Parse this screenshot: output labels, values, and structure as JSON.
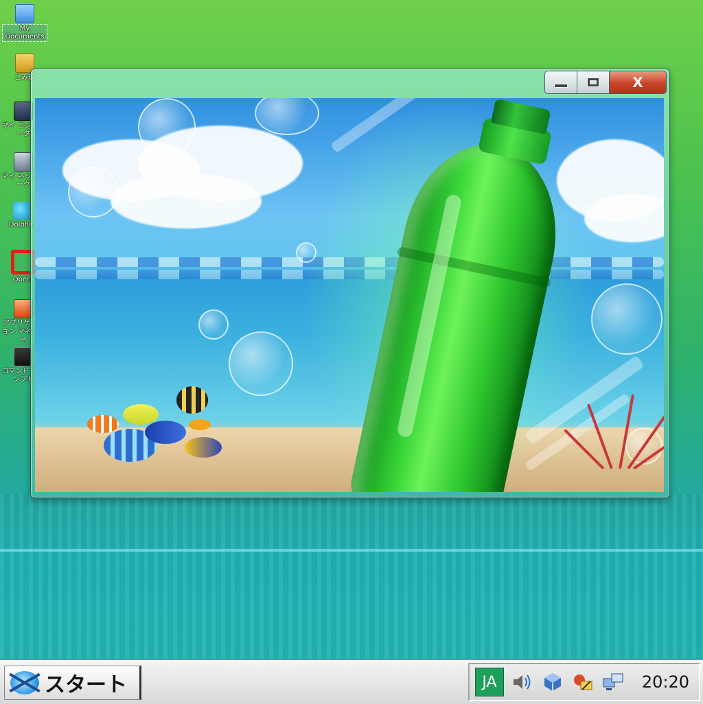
{
  "desktop": {
    "icons": [
      {
        "label": "My Documents",
        "icon": "folder-icon"
      },
      {
        "label": "ごみ箱",
        "icon": "trash-icon"
      },
      {
        "label": "マイ コンピュータ",
        "icon": "computer-icon"
      },
      {
        "label": "マイ ネットワーク",
        "icon": "network-icon"
      },
      {
        "label": "Dolphin",
        "icon": "dolphin-icon"
      },
      {
        "label": "Opera",
        "icon": "opera-icon"
      },
      {
        "label": "アプリケーション マネージャ",
        "icon": "app-manager-icon"
      },
      {
        "label": "コマンド プロンプト",
        "icon": "command-prompt-icon"
      }
    ]
  },
  "window": {
    "controls": {
      "minimize": "minimize",
      "maximize": "maximize",
      "close": "X"
    },
    "content_description": "image"
  },
  "taskbar": {
    "start_label": "スタート",
    "ime_indicator": "JA",
    "tray_icons": [
      "volume-icon",
      "network-status-icon",
      "security-icon",
      "connection-icon"
    ],
    "clock": "20:20"
  },
  "colors": {
    "close_button": "#c7442a",
    "ime_bg": "#1ea05a",
    "bottle_green": "#3bd83a"
  }
}
